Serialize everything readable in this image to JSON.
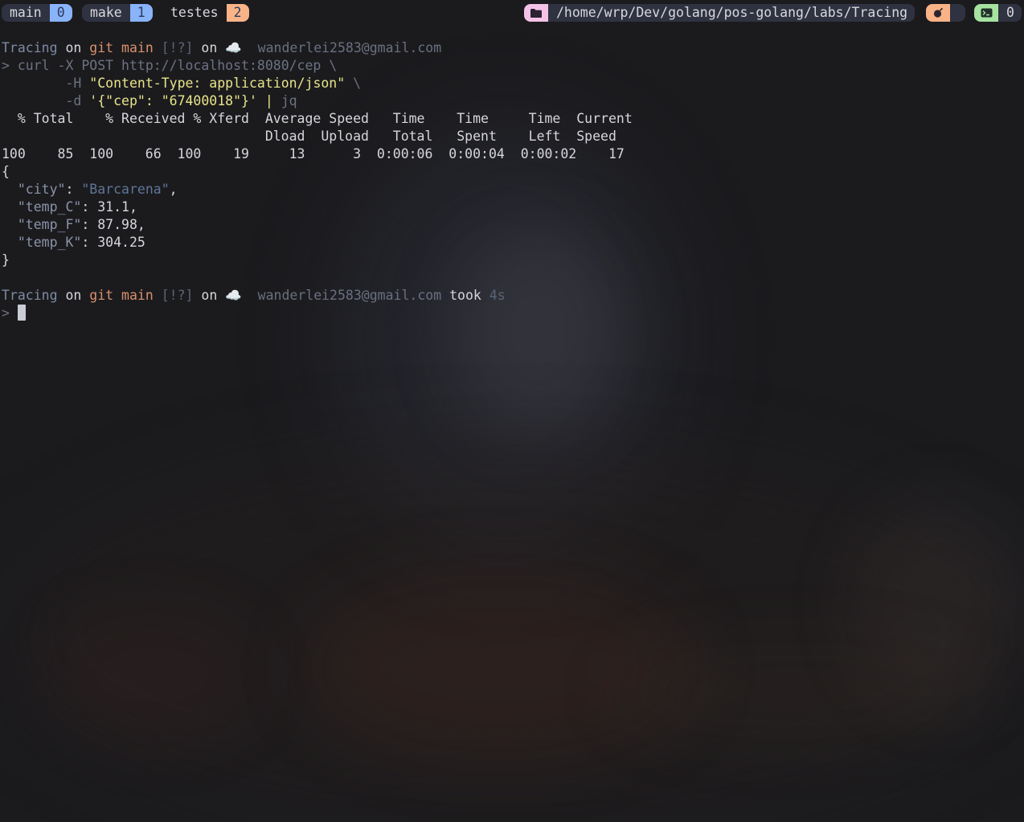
{
  "tmux": {
    "windows": [
      {
        "name": "main",
        "index": "0",
        "color": "#89b4fa"
      },
      {
        "name": "make",
        "index": "1",
        "color": "#89b4fa"
      },
      {
        "name": "testes",
        "index": "2",
        "color": "#fab387"
      }
    ],
    "path": "/home/wrp/Dev/golang/pos-golang/labs/Tracing",
    "session_count": "0",
    "icons": {
      "folder": "folder-icon",
      "session": "bomb-icon",
      "terminal": "terminal-icon"
    },
    "colors": {
      "folder_pill": "#f5c2e7",
      "session_pill": "#fab387",
      "terminal_pill": "#a6e3a1"
    }
  },
  "prompt1": {
    "dir": "Tracing",
    "on": " on ",
    "git": "git",
    "branch": "main",
    "status": "[!?]",
    "on2": " on ",
    "cloud": "☁️",
    "email": "wanderlei2583@gmail.com"
  },
  "command": {
    "l1_chev": "> ",
    "l1_cmd": "curl -X POST http://localhost:8080/cep \\",
    "l2_indent": "        ",
    "l2_flag": "-H ",
    "l2_str": "\"Content-Type: application/json\"",
    "l2_cont": " \\",
    "l3_indent": "        ",
    "l3_flag": "-d ",
    "l3_str": "'{\"cep\": \"67400018\"}'",
    "l3_pipe": " | ",
    "l3_jq": "jq"
  },
  "curl_progress": {
    "header1": "  % Total    % Received % Xferd  Average Speed   Time    Time     Time  Current",
    "header2": "                                 Dload  Upload   Total   Spent    Left  Speed",
    "row": "100    85  100    66  100    19     13      3  0:00:06  0:00:04  0:00:02    17"
  },
  "json_output": {
    "open": "{",
    "city_key": "\"city\"",
    "city_val": "\"Barcarena\"",
    "tc_key": "\"temp_C\"",
    "tc_val": "31.1,",
    "tf_key": "\"temp_F\"",
    "tf_val": "87.98,",
    "tk_key": "\"temp_K\"",
    "tk_val": "304.25",
    "close": "}"
  },
  "prompt2": {
    "dir": "Tracing",
    "on": " on ",
    "git": "git",
    "branch": "main",
    "status": "[!?]",
    "on2": " on ",
    "cloud": "☁️",
    "email": "wanderlei2583@gmail.com",
    "took": "took",
    "duration": "4s",
    "chev": ">"
  }
}
